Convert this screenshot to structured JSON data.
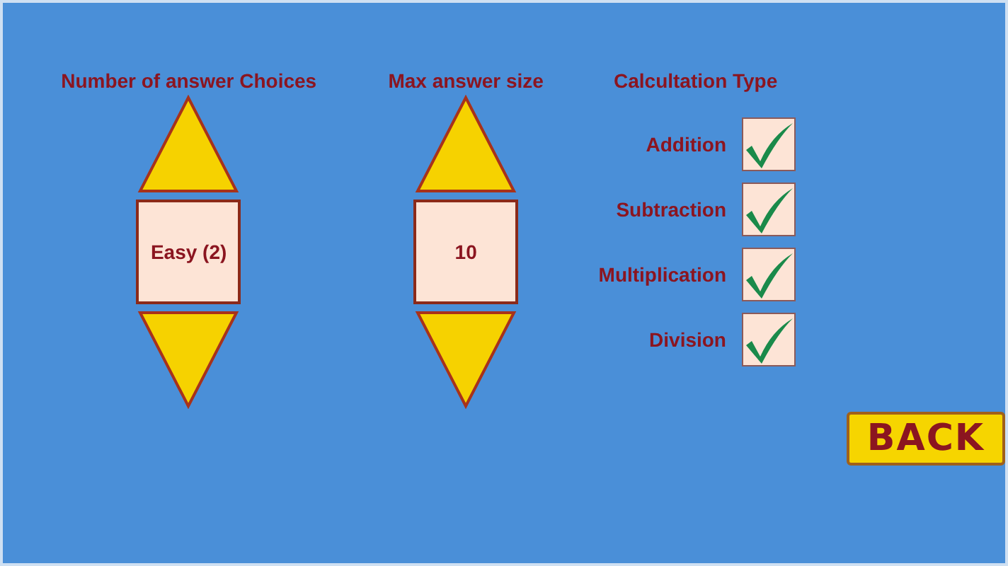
{
  "spinners": [
    {
      "title": "Number of answer Choices",
      "value": "Easy (2)"
    },
    {
      "title": "Max answer size",
      "value": "10"
    }
  ],
  "calculation_type": {
    "title": "Calcultation Type",
    "options": [
      {
        "label": "Addition",
        "checked": true
      },
      {
        "label": "Subtraction",
        "checked": true
      },
      {
        "label": "Multiplication",
        "checked": true
      },
      {
        "label": "Division",
        "checked": true
      }
    ]
  },
  "back_button": {
    "label": "BACK"
  }
}
